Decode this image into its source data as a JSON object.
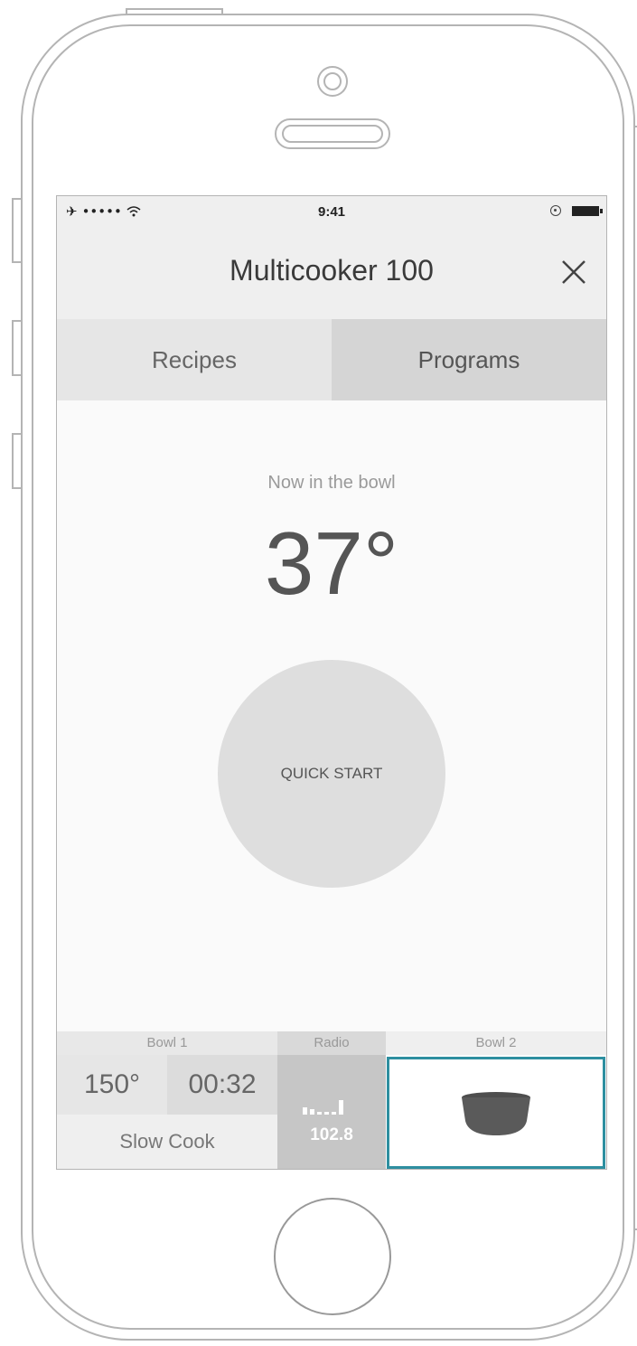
{
  "status_bar": {
    "signal": "•••••",
    "time": "9:41"
  },
  "nav": {
    "title": "Multicooker 100"
  },
  "tabs": [
    {
      "label": "Recipes"
    },
    {
      "label": "Programs"
    }
  ],
  "main": {
    "now_label": "Now in the bowl",
    "temperature": "37°",
    "quick_start_label": "QUICK START"
  },
  "bottom": {
    "bowl1": {
      "label": "Bowl 1",
      "temperature": "150°",
      "timer": "00:32",
      "mode": "Slow Cook"
    },
    "radio": {
      "label": "Radio",
      "frequency": "102.8"
    },
    "bowl2": {
      "label": "Bowl 2",
      "selected": true
    }
  },
  "colors": {
    "accent": "#2e8fa0",
    "pot": "#5a5a5a"
  },
  "icons": [
    "airplane-icon",
    "wifi-icon",
    "location-icon",
    "battery-icon",
    "close-icon",
    "signal-bars-icon",
    "bowl-icon"
  ]
}
